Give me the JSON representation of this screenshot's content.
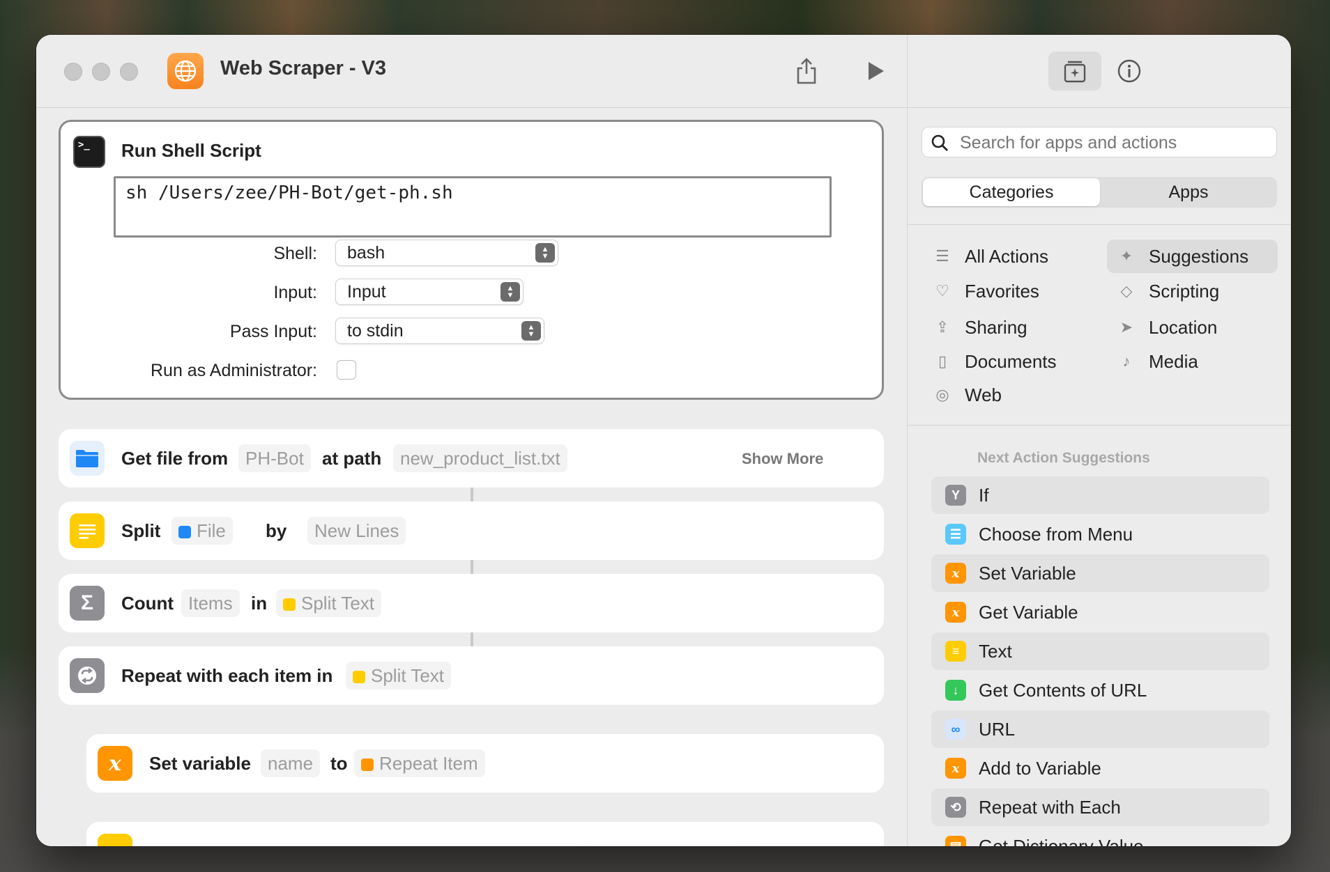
{
  "window": {
    "title": "Web Scraper - V3",
    "toolbar": {
      "share_icon": "share-icon",
      "run_icon": "play-icon"
    }
  },
  "editor": {
    "run_shell_script": {
      "title": "Run Shell Script",
      "script_code": "sh /Users/zee/PH-Bot/get-ph.sh",
      "shell_label": "Shell:",
      "shell_value": "bash",
      "input_label": "Input:",
      "input_value": "Input",
      "pass_input_label": "Pass Input:",
      "pass_input_value": "to stdin",
      "admin_label": "Run as Administrator:",
      "admin_checked": false
    },
    "get_file": {
      "label": "Get file from",
      "source": "PH-Bot",
      "at_path_label": "at path",
      "path": "new_product_list.txt",
      "show_more": "Show More"
    },
    "split": {
      "label": "Split",
      "input": "File",
      "by_label": "by",
      "separator": "New Lines"
    },
    "count": {
      "label": "Count",
      "what": "Items",
      "in_label": "in",
      "source": "Split Text"
    },
    "repeat": {
      "label": "Repeat with each item in",
      "source": "Split Text"
    },
    "set_variable": {
      "label": "Set variable",
      "name": "name",
      "to_label": "to",
      "value": "Repeat Item"
    }
  },
  "sidebar": {
    "search_placeholder": "Search for apps and actions",
    "tabs": {
      "categories": "Categories",
      "apps": "Apps"
    },
    "categories_left": [
      "All Actions",
      "Favorites",
      "Sharing",
      "Documents",
      "Web"
    ],
    "categories_right": [
      "Suggestions",
      "Scripting",
      "Location",
      "Media"
    ],
    "suggestions_heading": "Next Action Suggestions",
    "suggestions": [
      {
        "label": "If",
        "icon": "if-icon",
        "color": "#8e8e93"
      },
      {
        "label": "Choose from Menu",
        "icon": "menu-icon",
        "color": "#5ac8fa"
      },
      {
        "label": "Set Variable",
        "icon": "variable-icon",
        "color": "#ff9500"
      },
      {
        "label": "Get Variable",
        "icon": "variable-icon",
        "color": "#ff9500"
      },
      {
        "label": "Text",
        "icon": "text-icon",
        "color": "#ffcc00"
      },
      {
        "label": "Get Contents of URL",
        "icon": "download-icon",
        "color": "#34c759"
      },
      {
        "label": "URL",
        "icon": "link-icon",
        "color": "#d7e6fb"
      },
      {
        "label": "Add to Variable",
        "icon": "variable-icon",
        "color": "#ff9500"
      },
      {
        "label": "Repeat with Each",
        "icon": "repeat-icon",
        "color": "#8e8e93"
      },
      {
        "label": "Get Dictionary Value",
        "icon": "dictionary-icon",
        "color": "#ff9500"
      }
    ]
  },
  "colors": {
    "accent_orange": "#ff9500",
    "folder_blue": "#1e88f5",
    "text_yellow": "#ffcc00"
  }
}
